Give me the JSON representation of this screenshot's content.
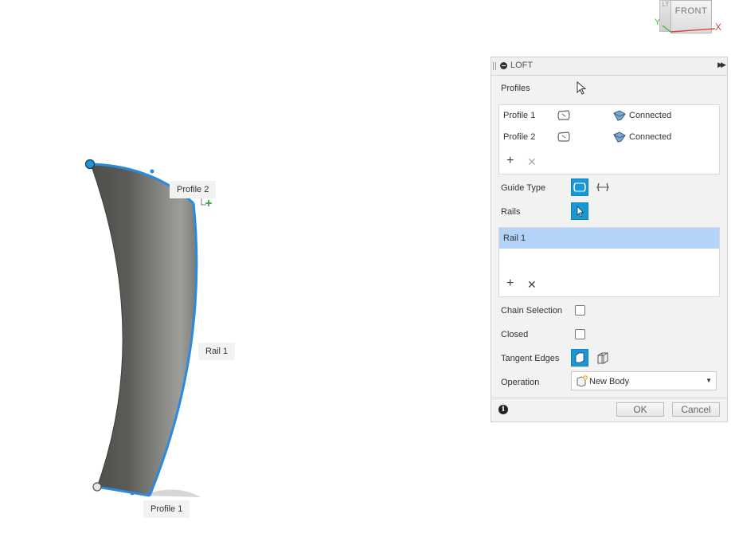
{
  "viewport": {
    "labels": {
      "profile_2": "Profile 2",
      "rail_1": "Rail 1",
      "profile_1": "Profile 1"
    },
    "viewcube": {
      "face": "FRONT",
      "side": "LT",
      "x_axis": "X",
      "y_axis": "Y"
    }
  },
  "panel": {
    "title": "LOFT",
    "profiles_label": "Profiles",
    "profiles": [
      {
        "name": "Profile 1",
        "status": "Connected"
      },
      {
        "name": "Profile 2",
        "status": "Connected"
      }
    ],
    "guide_type_label": "Guide Type",
    "rails_label": "Rails",
    "rails": [
      {
        "name": "Rail 1"
      }
    ],
    "chain_selection_label": "Chain Selection",
    "chain_selection_checked": false,
    "closed_label": "Closed",
    "closed_checked": false,
    "tangent_edges_label": "Tangent Edges",
    "operation_label": "Operation",
    "operation_value": "New Body",
    "ok_label": "OK",
    "cancel_label": "Cancel"
  },
  "colors": {
    "accent": "#1a97d5",
    "selection_row": "#b4d3f8",
    "curve_highlight": "#2a8ae0",
    "surface_dark": "#5a5955",
    "surface_light": "#9a9a96"
  }
}
